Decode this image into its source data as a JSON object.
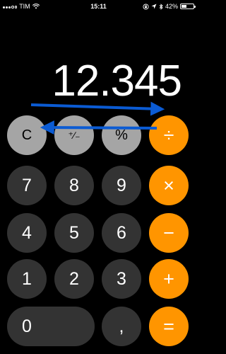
{
  "status_bar": {
    "carrier": "TIM",
    "time": "15:11",
    "battery": "42%",
    "battery_level": 0.42,
    "icons": [
      "signal-icon",
      "wifi-icon",
      "lock-rotation-icon",
      "location-icon",
      "bluetooth-icon",
      "battery-icon"
    ]
  },
  "display": {
    "value": "12.345"
  },
  "keypad": {
    "rows": [
      [
        {
          "label": "C",
          "style": "light"
        },
        {
          "label": "⁺∕₋",
          "style": "light"
        },
        {
          "label": "%",
          "style": "light"
        },
        {
          "label": "÷",
          "style": "op"
        }
      ],
      [
        {
          "label": "7",
          "style": "dark"
        },
        {
          "label": "8",
          "style": "dark"
        },
        {
          "label": "9",
          "style": "dark"
        },
        {
          "label": "×",
          "style": "op"
        }
      ],
      [
        {
          "label": "4",
          "style": "dark"
        },
        {
          "label": "5",
          "style": "dark"
        },
        {
          "label": "6",
          "style": "dark"
        },
        {
          "label": "−",
          "style": "op"
        }
      ],
      [
        {
          "label": "1",
          "style": "dark"
        },
        {
          "label": "2",
          "style": "dark"
        },
        {
          "label": "3",
          "style": "dark"
        },
        {
          "label": "+",
          "style": "op"
        }
      ],
      [
        {
          "label": "0",
          "style": "dark"
        },
        {
          "label": ",",
          "style": "dark"
        },
        {
          "label": "=",
          "style": "op"
        }
      ]
    ]
  },
  "annotation": {
    "arrows": [
      "swipe-right-arrow",
      "swipe-left-arrow"
    ],
    "color": "#0b5bd3"
  },
  "colors": {
    "background": "#000000",
    "dark_key": "#333333",
    "light_key": "#a5a5a5",
    "operator_key": "#ff9500"
  }
}
